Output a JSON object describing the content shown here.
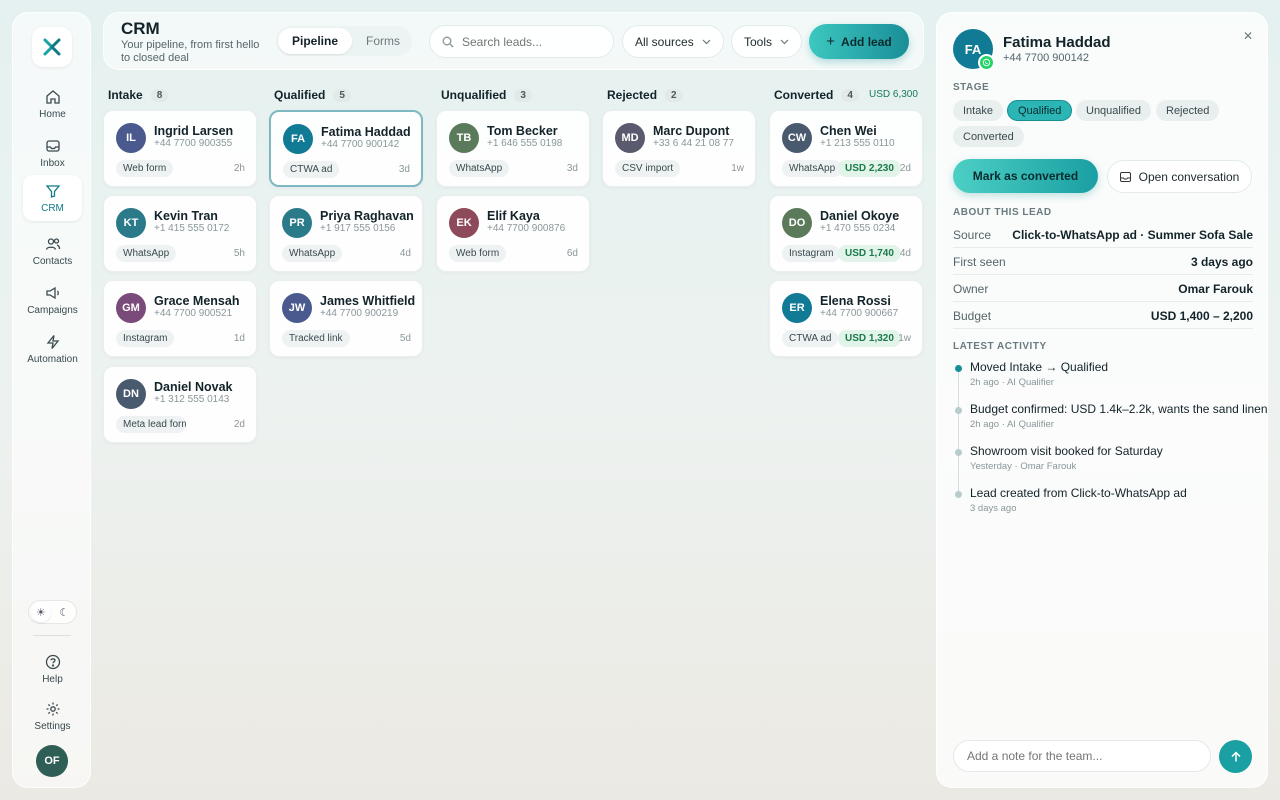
{
  "sidebar": {
    "nav": [
      {
        "label": "Home",
        "icon": "home-icon"
      },
      {
        "label": "Inbox",
        "icon": "inbox-icon"
      },
      {
        "label": "CRM",
        "icon": "filter-icon"
      },
      {
        "label": "Contacts",
        "icon": "users-icon"
      },
      {
        "label": "Campaigns",
        "icon": "megaphone-icon"
      },
      {
        "label": "Automation",
        "icon": "lightning-icon"
      }
    ],
    "help": "Help",
    "settings": "Settings",
    "user_initials": "OF"
  },
  "header": {
    "title": "CRM",
    "subtitle": "Your pipeline, from first hello to closed deal",
    "tabs": [
      "Pipeline",
      "Forms"
    ],
    "search_placeholder": "Search leads...",
    "sources_label": "All sources",
    "tools_label": "Tools",
    "add_lead_label": "Add lead"
  },
  "columns": [
    {
      "name": "Intake",
      "count": "8",
      "total": "",
      "cards": [
        {
          "initials": "IL",
          "name": "Ingrid Larsen",
          "phone": "+44 7700 900355",
          "source": "Web form",
          "amount": "",
          "age": "2h",
          "color": "#4a5a8e"
        },
        {
          "initials": "KT",
          "name": "Kevin Tran",
          "phone": "+1 415 555 0172",
          "source": "WhatsApp",
          "amount": "",
          "age": "5h",
          "color": "#2b7a8a"
        },
        {
          "initials": "GM",
          "name": "Grace Mensah",
          "phone": "+44 7700 900521",
          "source": "Instagram",
          "amount": "",
          "age": "1d",
          "color": "#7a4a7a"
        },
        {
          "initials": "DN",
          "name": "Daniel Novak",
          "phone": "+1 312 555 0143",
          "source": "Meta lead form",
          "amount": "",
          "age": "2d",
          "color": "#4a5a6e"
        }
      ]
    },
    {
      "name": "Qualified",
      "count": "5",
      "total": "",
      "cards": [
        {
          "initials": "FA",
          "name": "Fatima Haddad",
          "phone": "+44 7700 900142",
          "source": "CTWA ad",
          "amount": "",
          "age": "3d",
          "color": "#117a95"
        },
        {
          "initials": "PR",
          "name": "Priya Raghavan",
          "phone": "+1 917 555 0156",
          "source": "WhatsApp",
          "amount": "",
          "age": "4d",
          "color": "#2b7a8a"
        },
        {
          "initials": "JW",
          "name": "James Whitfield",
          "phone": "+44 7700 900219",
          "source": "Tracked link",
          "amount": "",
          "age": "5d",
          "color": "#4a5a8e"
        }
      ]
    },
    {
      "name": "Unqualified",
      "count": "3",
      "total": "",
      "cards": [
        {
          "initials": "TB",
          "name": "Tom Becker",
          "phone": "+1 646 555 0198",
          "source": "WhatsApp",
          "amount": "",
          "age": "3d",
          "color": "#5a7a5a"
        },
        {
          "initials": "EK",
          "name": "Elif Kaya",
          "phone": "+44 7700 900876",
          "source": "Web form",
          "amount": "",
          "age": "6d",
          "color": "#8e4a5a"
        }
      ]
    },
    {
      "name": "Rejected",
      "count": "2",
      "total": "",
      "cards": [
        {
          "initials": "MD",
          "name": "Marc Dupont",
          "phone": "+33 6 44 21 08 77",
          "source": "CSV import",
          "amount": "",
          "age": "1w",
          "color": "#5a5a6e"
        }
      ]
    },
    {
      "name": "Converted",
      "count": "4",
      "total": "USD 6,300",
      "cards": [
        {
          "initials": "CW",
          "name": "Chen Wei",
          "phone": "+1 213 555 0110",
          "source": "WhatsApp",
          "amount": "USD 2,230",
          "age": "2d",
          "color": "#4a5a6e"
        },
        {
          "initials": "DO",
          "name": "Daniel Okoye",
          "phone": "+1 470 555 0234",
          "source": "Instagram",
          "amount": "USD 1,740",
          "age": "4d",
          "color": "#5a7a5a"
        },
        {
          "initials": "ER",
          "name": "Elena Rossi",
          "phone": "+44 7700 900667",
          "source": "CTWA ad",
          "amount": "USD 1,320",
          "age": "1w",
          "color": "#117a95"
        }
      ]
    }
  ],
  "panel": {
    "initials": "FA",
    "name": "Fatima Haddad",
    "phone": "+44 7700 900142",
    "stage_label": "STAGE",
    "stages": [
      "Intake",
      "Qualified",
      "Unqualified",
      "Rejected",
      "Converted"
    ],
    "active_stage": "Qualified",
    "convert_label": "Mark as converted",
    "open_conv_label": "Open conversation",
    "about_label": "ABOUT THIS LEAD",
    "about": [
      {
        "k": "Source",
        "v": "Click-to-WhatsApp ad · Summer Sofa Sale"
      },
      {
        "k": "First seen",
        "v": "3 days ago"
      },
      {
        "k": "Owner",
        "v": "Omar Farouk"
      },
      {
        "k": "Budget",
        "v": "USD 1,400 – 2,200"
      }
    ],
    "activity_label": "LATEST ACTIVITY",
    "activity": [
      {
        "t": "Moved Intake → Qualified",
        "m": "2h ago · AI Qualifier",
        "active": true
      },
      {
        "t": "Budget confirmed: USD 1.4k–2.2k, wants the sand linen",
        "m": "2h ago · AI Qualifier",
        "active": false
      },
      {
        "t": "Showroom visit booked for Saturday",
        "m": "Yesterday · Omar Farouk",
        "active": false
      },
      {
        "t": "Lead created from Click-to-WhatsApp ad",
        "m": "3 days ago",
        "active": false
      }
    ],
    "note_placeholder": "Add a note for the team..."
  }
}
